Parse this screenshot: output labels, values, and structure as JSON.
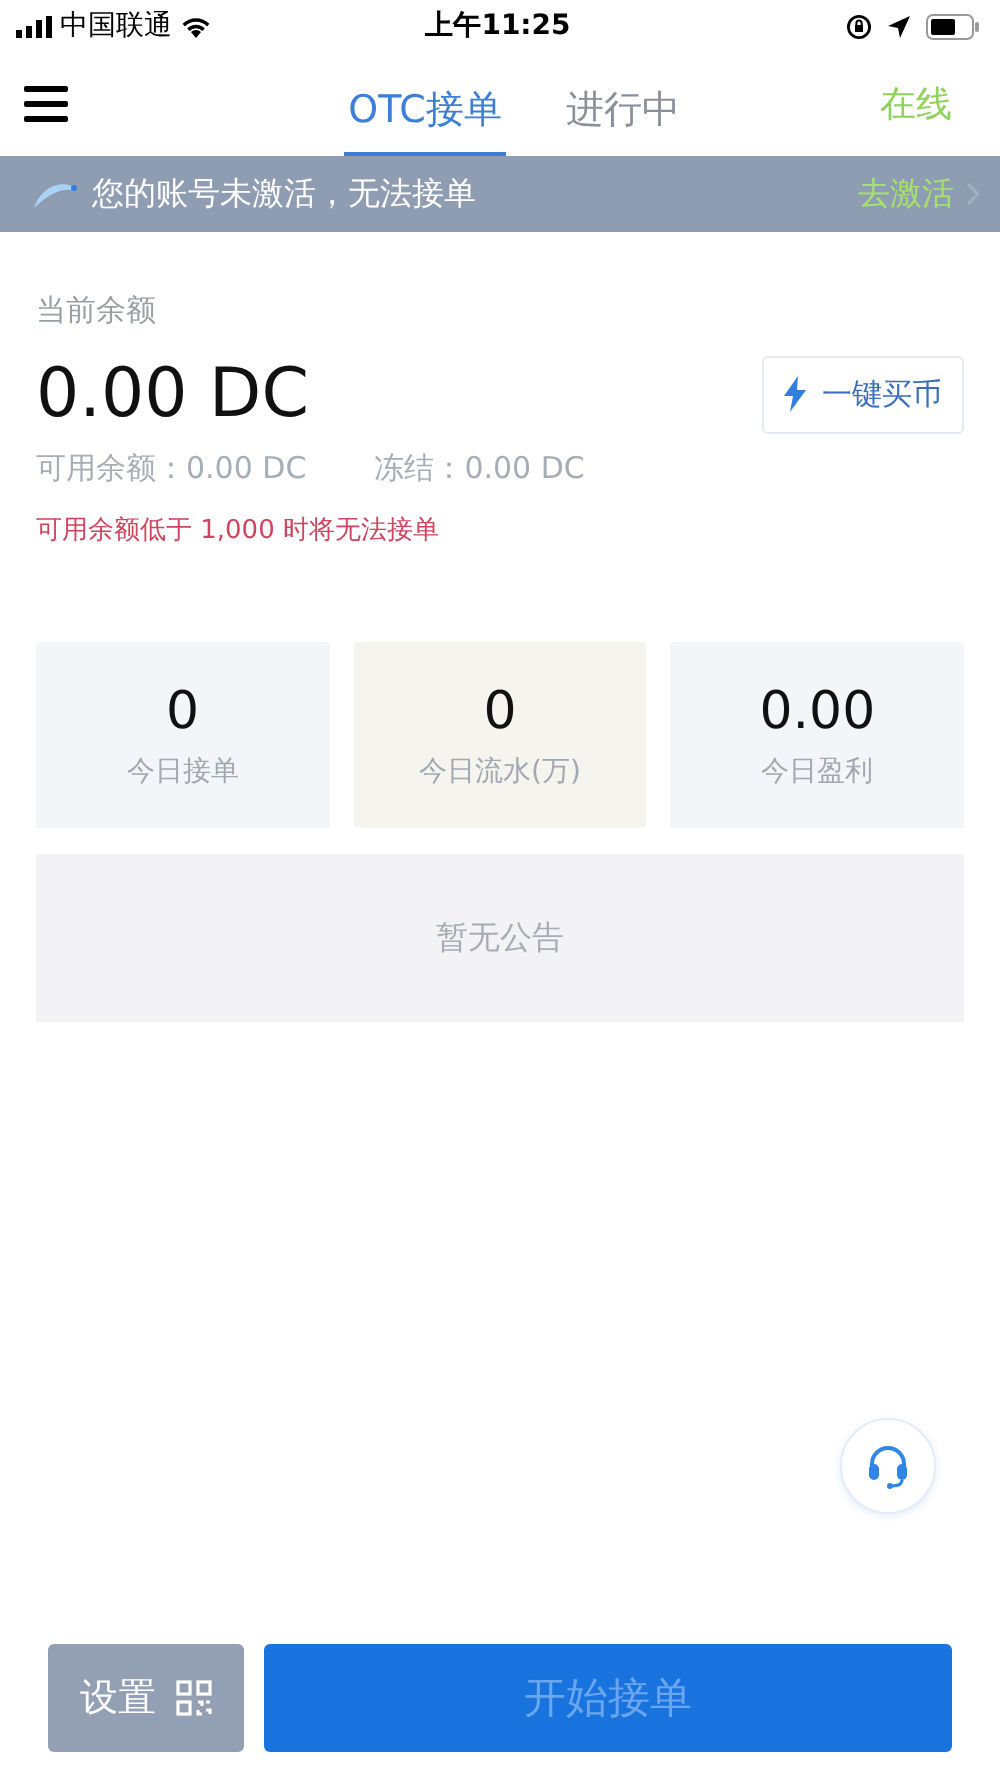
{
  "status_bar": {
    "carrier": "中国联通",
    "time": "上午11:25"
  },
  "nav": {
    "tabs": [
      {
        "label": "OTC接单",
        "selected": true
      },
      {
        "label": "进行中",
        "selected": false
      }
    ],
    "status": "在线"
  },
  "banner": {
    "message": "您的账号未激活，无法接单",
    "action": "去激活"
  },
  "balance": {
    "label": "当前余额",
    "amount": "0.00 DC",
    "available": "可用余额：0.00 DC",
    "frozen": "冻结：0.00 DC",
    "warning": "可用余额低于 1,000 时将无法接单",
    "buy_button": "一键买币"
  },
  "stats": [
    {
      "value": "0",
      "label": "今日接单",
      "color": "#f3f5f8"
    },
    {
      "value": "0",
      "label": "今日流水(万)",
      "color": "#f6f4ef"
    },
    {
      "value": "0.00",
      "label": "今日盈利",
      "color": "#f3f5f8"
    }
  ],
  "announcement": "暂无公告",
  "footer": {
    "settings_button": "设置",
    "start_button": {
      "label": "开始接单",
      "disabled": true
    }
  }
}
